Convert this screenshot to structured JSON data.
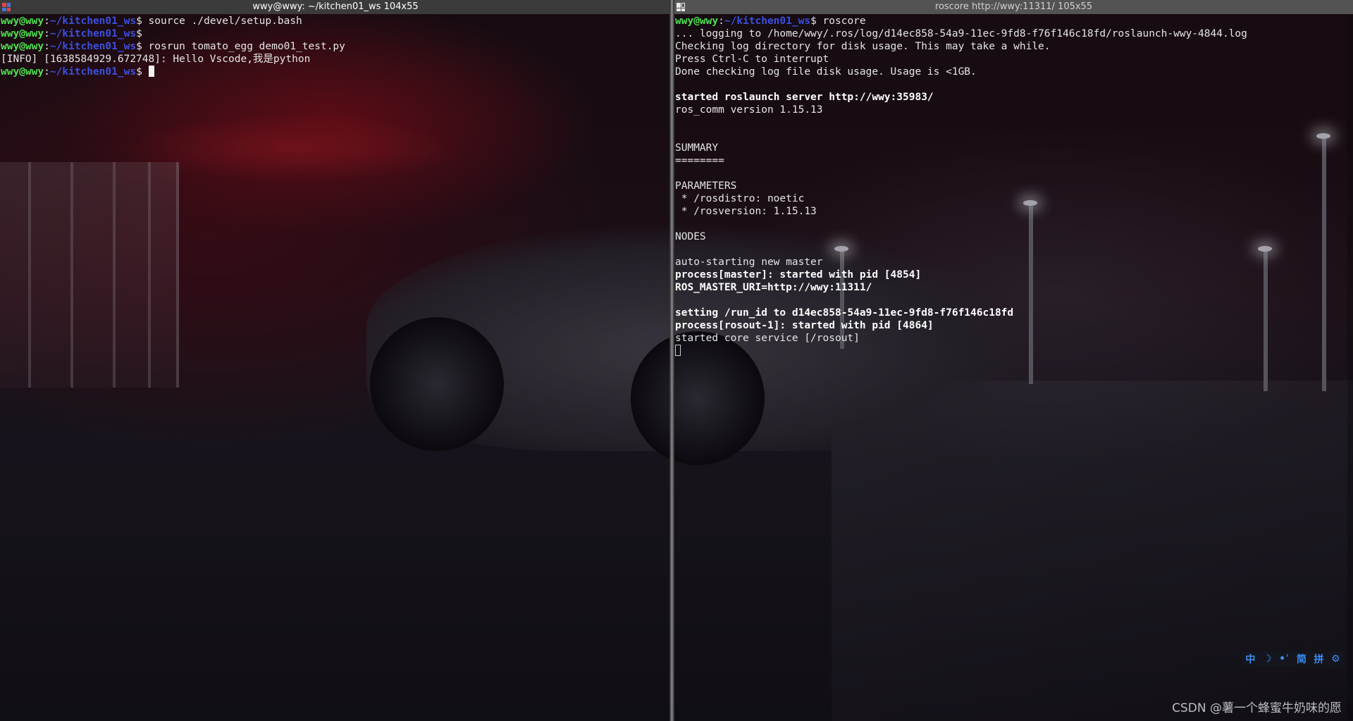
{
  "left_terminal": {
    "title": "wwy@wwy: ~/kitchen01_ws 104x55",
    "prompt_user": "wwy@wwy",
    "prompt_sep": ":",
    "prompt_path": "~/kitchen01_ws",
    "prompt_end": "$ ",
    "lines": [
      {
        "type": "prompt",
        "cmd": "source ./devel/setup.bash"
      },
      {
        "type": "prompt",
        "cmd": ""
      },
      {
        "type": "prompt",
        "cmd": "rosrun tomato_egg demo01_test.py"
      },
      {
        "type": "output",
        "text": "[INFO] [1638584929.672748]: Hello Vscode,我是python"
      },
      {
        "type": "prompt",
        "cmd": "",
        "cursor": true
      }
    ]
  },
  "right_terminal": {
    "title": "roscore http://wwy:11311/ 105x55",
    "prompt_user": "wwy@wwy",
    "prompt_sep": ":",
    "prompt_path": "~/kitchen01_ws",
    "prompt_end": "$ ",
    "lines": [
      {
        "type": "prompt",
        "cmd": "roscore"
      },
      {
        "type": "output",
        "text": "... logging to /home/wwy/.ros/log/d14ec858-54a9-11ec-9fd8-f76f146c18fd/roslaunch-wwy-4844.log"
      },
      {
        "type": "output",
        "text": "Checking log directory for disk usage. This may take a while."
      },
      {
        "type": "output",
        "text": "Press Ctrl-C to interrupt"
      },
      {
        "type": "output",
        "text": "Done checking log file disk usage. Usage is <1GB."
      },
      {
        "type": "output",
        "text": ""
      },
      {
        "type": "bold",
        "text": "started roslaunch server http://wwy:35983/"
      },
      {
        "type": "output",
        "text": "ros_comm version 1.15.13"
      },
      {
        "type": "output",
        "text": ""
      },
      {
        "type": "output",
        "text": ""
      },
      {
        "type": "output",
        "text": "SUMMARY"
      },
      {
        "type": "output",
        "text": "========"
      },
      {
        "type": "output",
        "text": ""
      },
      {
        "type": "output",
        "text": "PARAMETERS"
      },
      {
        "type": "output",
        "text": " * /rosdistro: noetic"
      },
      {
        "type": "output",
        "text": " * /rosversion: 1.15.13"
      },
      {
        "type": "output",
        "text": ""
      },
      {
        "type": "output",
        "text": "NODES"
      },
      {
        "type": "output",
        "text": ""
      },
      {
        "type": "output",
        "text": "auto-starting new master"
      },
      {
        "type": "bold",
        "text": "process[master]: started with pid [4854]"
      },
      {
        "type": "bold",
        "text": "ROS_MASTER_URI=http://wwy:11311/"
      },
      {
        "type": "output",
        "text": ""
      },
      {
        "type": "bold",
        "text": "setting /run_id to d14ec858-54a9-11ec-9fd8-f76f146c18fd"
      },
      {
        "type": "bold",
        "text": "process[rosout-1]: started with pid [4864]"
      },
      {
        "type": "output",
        "text": "started core service [/rosout]"
      },
      {
        "type": "cursor_only"
      }
    ]
  },
  "ime_tray": {
    "items": [
      "中",
      "☽",
      "•ʾ",
      "简",
      "拼",
      "⚙"
    ],
    "color": "#3a8ef6"
  },
  "watermark": "CSDN @薯一个蜂蜜牛奶味的愿"
}
